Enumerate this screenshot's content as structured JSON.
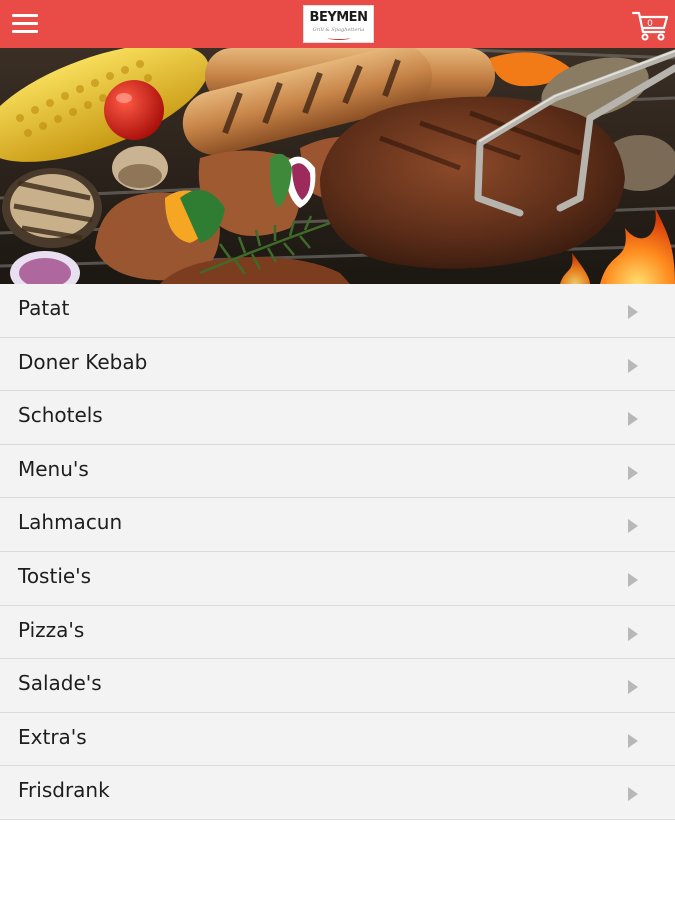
{
  "header": {
    "logo_main": "BEYMEN",
    "logo_sub": "Grill & Spaghetteria",
    "cart_count": "0",
    "menu_icon": "hamburger-menu-icon",
    "cart_icon": "shopping-cart-icon",
    "color": "#e94b47"
  },
  "hero": {
    "image": "grilled-meats-and-vegetables-on-barbecue"
  },
  "menu": {
    "items": [
      {
        "label": "Patat"
      },
      {
        "label": "Doner Kebab"
      },
      {
        "label": "Schotels"
      },
      {
        "label": "Menu's"
      },
      {
        "label": "Lahmacun"
      },
      {
        "label": "Tostie's"
      },
      {
        "label": "Pizza's"
      },
      {
        "label": "Salade's"
      },
      {
        "label": "Extra's"
      },
      {
        "label": "Frisdrank"
      }
    ],
    "arrow_icon": "chevron-right-icon"
  }
}
